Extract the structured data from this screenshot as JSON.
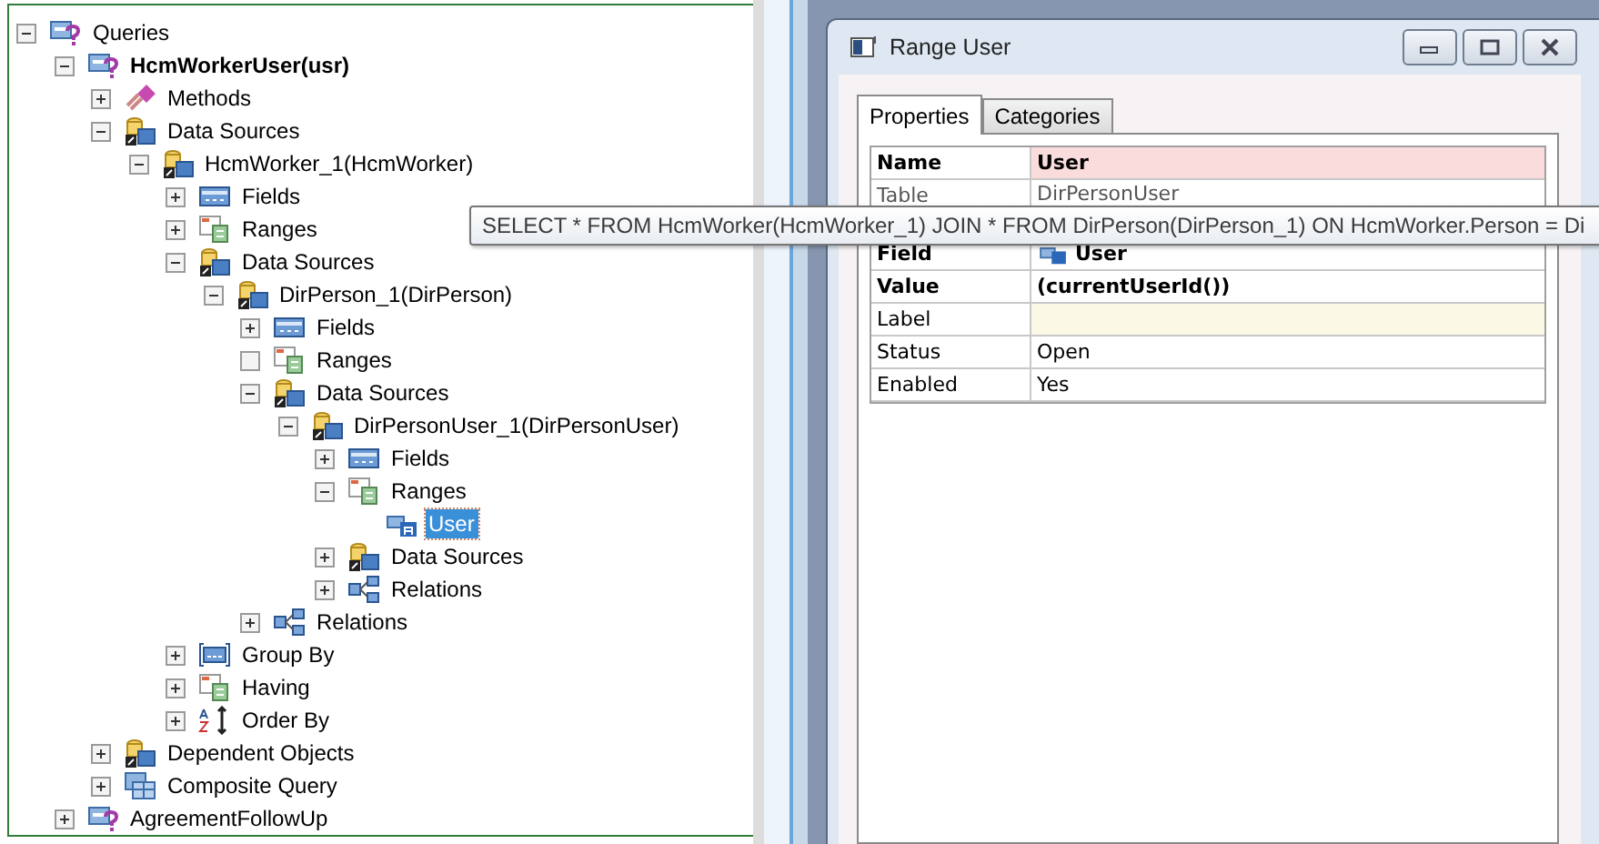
{
  "tree": [
    {
      "label": "Queries",
      "kind": "query",
      "expanded": true,
      "empty": false,
      "bold": false,
      "selected": false,
      "children": [
        {
          "label": "HcmWorkerUser(usr)",
          "kind": "query",
          "expanded": true,
          "empty": false,
          "bold": true,
          "selected": false,
          "children": [
            {
              "label": "Methods",
              "kind": "methods",
              "expanded": false,
              "empty": false,
              "bold": false,
              "selected": false
            },
            {
              "label": "Data Sources",
              "kind": "datasource",
              "expanded": true,
              "empty": false,
              "bold": false,
              "selected": false,
              "children": [
                {
                  "label": "HcmWorker_1(HcmWorker)",
                  "kind": "datasource",
                  "expanded": true,
                  "empty": false,
                  "bold": false,
                  "selected": false,
                  "children": [
                    {
                      "label": "Fields",
                      "kind": "fields",
                      "expanded": false,
                      "empty": false,
                      "bold": false,
                      "selected": false
                    },
                    {
                      "label": "Ranges",
                      "kind": "ranges",
                      "expanded": false,
                      "empty": false,
                      "bold": false,
                      "selected": false
                    },
                    {
                      "label": "Data Sources",
                      "kind": "datasource",
                      "expanded": true,
                      "empty": false,
                      "bold": false,
                      "selected": false,
                      "children": [
                        {
                          "label": "DirPerson_1(DirPerson)",
                          "kind": "datasource",
                          "expanded": true,
                          "empty": false,
                          "bold": false,
                          "selected": false,
                          "children": [
                            {
                              "label": "Fields",
                              "kind": "fields",
                              "expanded": false,
                              "empty": false,
                              "bold": false,
                              "selected": false
                            },
                            {
                              "label": "Ranges",
                              "kind": "ranges",
                              "empty": true,
                              "bold": false,
                              "selected": false
                            },
                            {
                              "label": "Data Sources",
                              "kind": "datasource",
                              "expanded": true,
                              "empty": false,
                              "bold": false,
                              "selected": false,
                              "children": [
                                {
                                  "label": "DirPersonUser_1(DirPersonUser)",
                                  "kind": "datasource",
                                  "expanded": true,
                                  "empty": false,
                                  "bold": false,
                                  "selected": false,
                                  "children": [
                                    {
                                      "label": "Fields",
                                      "kind": "fields",
                                      "expanded": false,
                                      "empty": false,
                                      "bold": false,
                                      "selected": false
                                    },
                                    {
                                      "label": "Ranges",
                                      "kind": "ranges",
                                      "expanded": true,
                                      "empty": false,
                                      "bold": false,
                                      "selected": false,
                                      "children": [
                                        {
                                          "label": "User",
                                          "kind": "field",
                                          "bold": false,
                                          "selected": true
                                        }
                                      ]
                                    },
                                    {
                                      "label": "Data Sources",
                                      "kind": "datasource",
                                      "expanded": false,
                                      "empty": false,
                                      "bold": false,
                                      "selected": false
                                    },
                                    {
                                      "label": "Relations",
                                      "kind": "relations",
                                      "expanded": false,
                                      "empty": false,
                                      "bold": false,
                                      "selected": false
                                    }
                                  ]
                                }
                              ]
                            },
                            {
                              "label": "Relations",
                              "kind": "relations",
                              "expanded": false,
                              "empty": false,
                              "bold": false,
                              "selected": false
                            }
                          ]
                        }
                      ]
                    },
                    {
                      "label": "Group By",
                      "kind": "groupby",
                      "expanded": false,
                      "empty": false,
                      "bold": false,
                      "selected": false
                    },
                    {
                      "label": "Having",
                      "kind": "ranges",
                      "expanded": false,
                      "empty": false,
                      "bold": false,
                      "selected": false
                    },
                    {
                      "label": "Order By",
                      "kind": "orderby",
                      "expanded": false,
                      "empty": false,
                      "bold": false,
                      "selected": false
                    }
                  ]
                }
              ]
            },
            {
              "label": "Dependent Objects",
              "kind": "datasource",
              "expanded": false,
              "empty": false,
              "bold": false,
              "selected": false
            },
            {
              "label": "Composite Query",
              "kind": "composite",
              "expanded": false,
              "empty": false,
              "bold": false,
              "selected": false
            }
          ]
        },
        {
          "label": "AgreementFollowUp",
          "kind": "query",
          "expanded": false,
          "empty": false,
          "bold": false,
          "selected": false
        }
      ]
    }
  ],
  "tooltip": "SELECT * FROM HcmWorker(HcmWorker_1) JOIN * FROM DirPerson(DirPerson_1) ON HcmWorker.Person = Di",
  "window": {
    "title": "Range User"
  },
  "tabs": [
    {
      "label": "Properties",
      "selected": true
    },
    {
      "label": "Categories",
      "selected": false
    }
  ],
  "properties": [
    {
      "name": "Name",
      "value": "User",
      "kind": "text",
      "bold": true,
      "color": "#fadcdc"
    },
    {
      "name": "Table",
      "value": "DirPersonUser",
      "kind": "text",
      "bold": false
    },
    {
      "name": "Field",
      "value": "User",
      "kind": "field",
      "bold": true
    },
    {
      "name": "Value",
      "value": "(currentUserId())",
      "kind": "text",
      "bold": true
    },
    {
      "name": "Label",
      "kind": "text",
      "bold": false,
      "color": "#fbf9e6"
    },
    {
      "name": "Status",
      "value": "Open",
      "kind": "text",
      "bold": false
    },
    {
      "name": "Enabled",
      "value": "Yes",
      "kind": "text",
      "bold": false
    }
  ]
}
